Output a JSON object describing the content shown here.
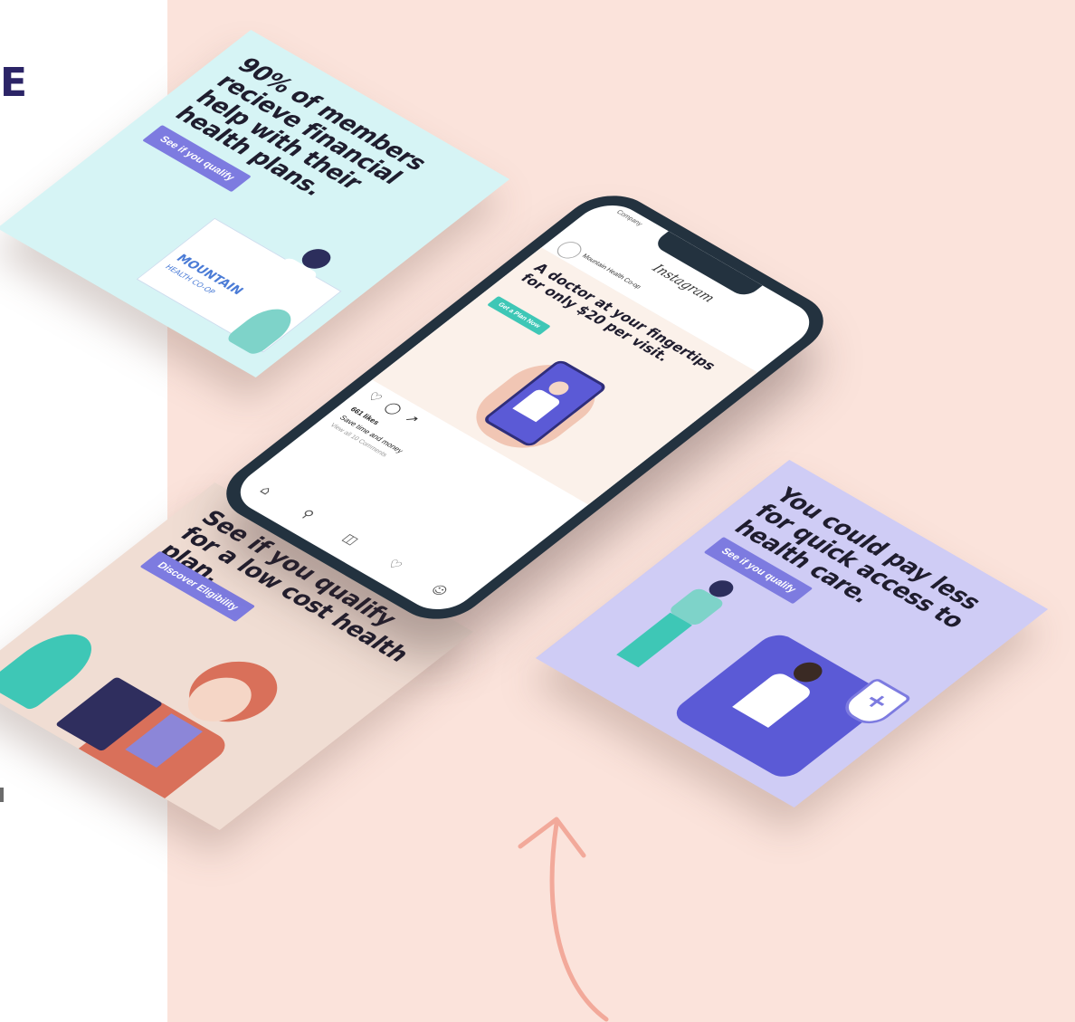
{
  "edge_letter": "E",
  "cards": {
    "top_left": {
      "headline": "90% of members recieve financial help with their health plans.",
      "cta": "See if you qualify",
      "logo_text": "MOUNTAIN",
      "logo_subtext": "HEALTH CO-OP",
      "bg_color": "#d6f4f5"
    },
    "bottom_left": {
      "headline": "See if you qualify for a low cost health plan.",
      "cta": "Discover Eligibility",
      "bg_color": "#f0ddd3"
    },
    "right": {
      "headline": "You could pay less for quick access to health care.",
      "cta": "See if you qualify",
      "bg_color": "#cfccf5"
    }
  },
  "phone": {
    "status_text": "Company",
    "app_name": "Instagram",
    "account_name": "Mountain Health Co-op",
    "post_headline": "A doctor at your fingertips for only $20 per visit.",
    "post_cta": "Get a Plan Now",
    "likes": "661 likes",
    "caption": "Save time and money",
    "comments": "View all 10 Comments",
    "action_icons": [
      "heart-icon",
      "comment-icon",
      "share-icon"
    ],
    "nav_icons": [
      "home-icon",
      "search-icon",
      "camera-icon",
      "heart-icon",
      "profile-icon"
    ]
  },
  "colors": {
    "background_peach": "#fbe3db",
    "accent_purple": "#7d7be0",
    "accent_teal": "#3ec7b6",
    "phone_frame": "#23323f"
  }
}
